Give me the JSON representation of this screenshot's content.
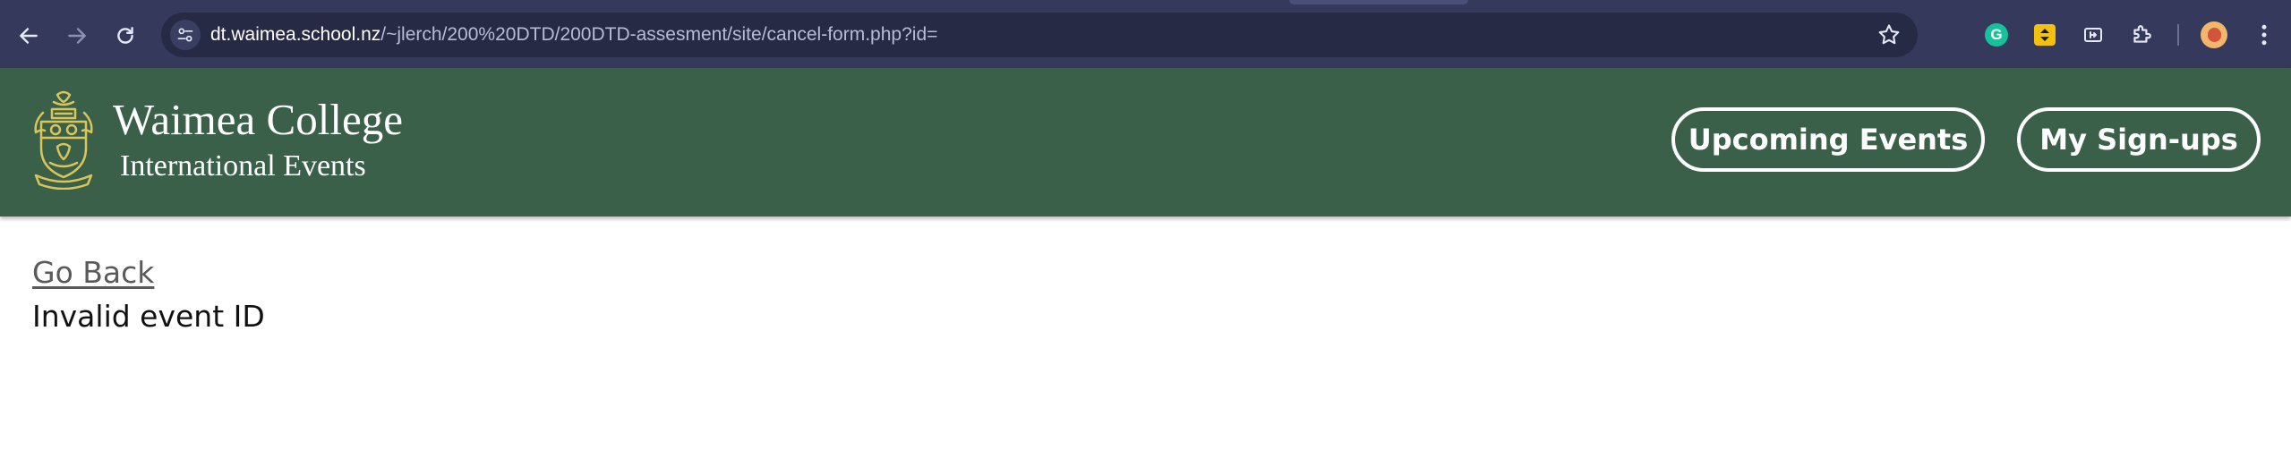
{
  "browser": {
    "url_host": "dt.waimea.school.nz",
    "url_path": "/~jlerch/200%20DTD/200DTD-assesment/site/cancel-form.php?id=",
    "icons": {
      "back": "arrow-left-icon",
      "forward": "arrow-right-icon",
      "reload": "reload-icon",
      "site_info": "tune-icon",
      "bookmark": "star-icon",
      "extensions": [
        "grammarly-icon",
        "yellow-extension-icon",
        "media-extension-icon",
        "puzzle-icon"
      ],
      "menu": "kebab-menu-icon"
    },
    "grammarly_letter": "G"
  },
  "header": {
    "title": "Waimea College",
    "subtitle": "International Events",
    "nav": {
      "upcoming": "Upcoming Events",
      "signups": "My Sign-ups"
    },
    "colors": {
      "header_bg": "#3b604a",
      "crest": "#d9c55a"
    }
  },
  "main": {
    "back_link": "Go Back",
    "message": "Invalid event ID"
  }
}
